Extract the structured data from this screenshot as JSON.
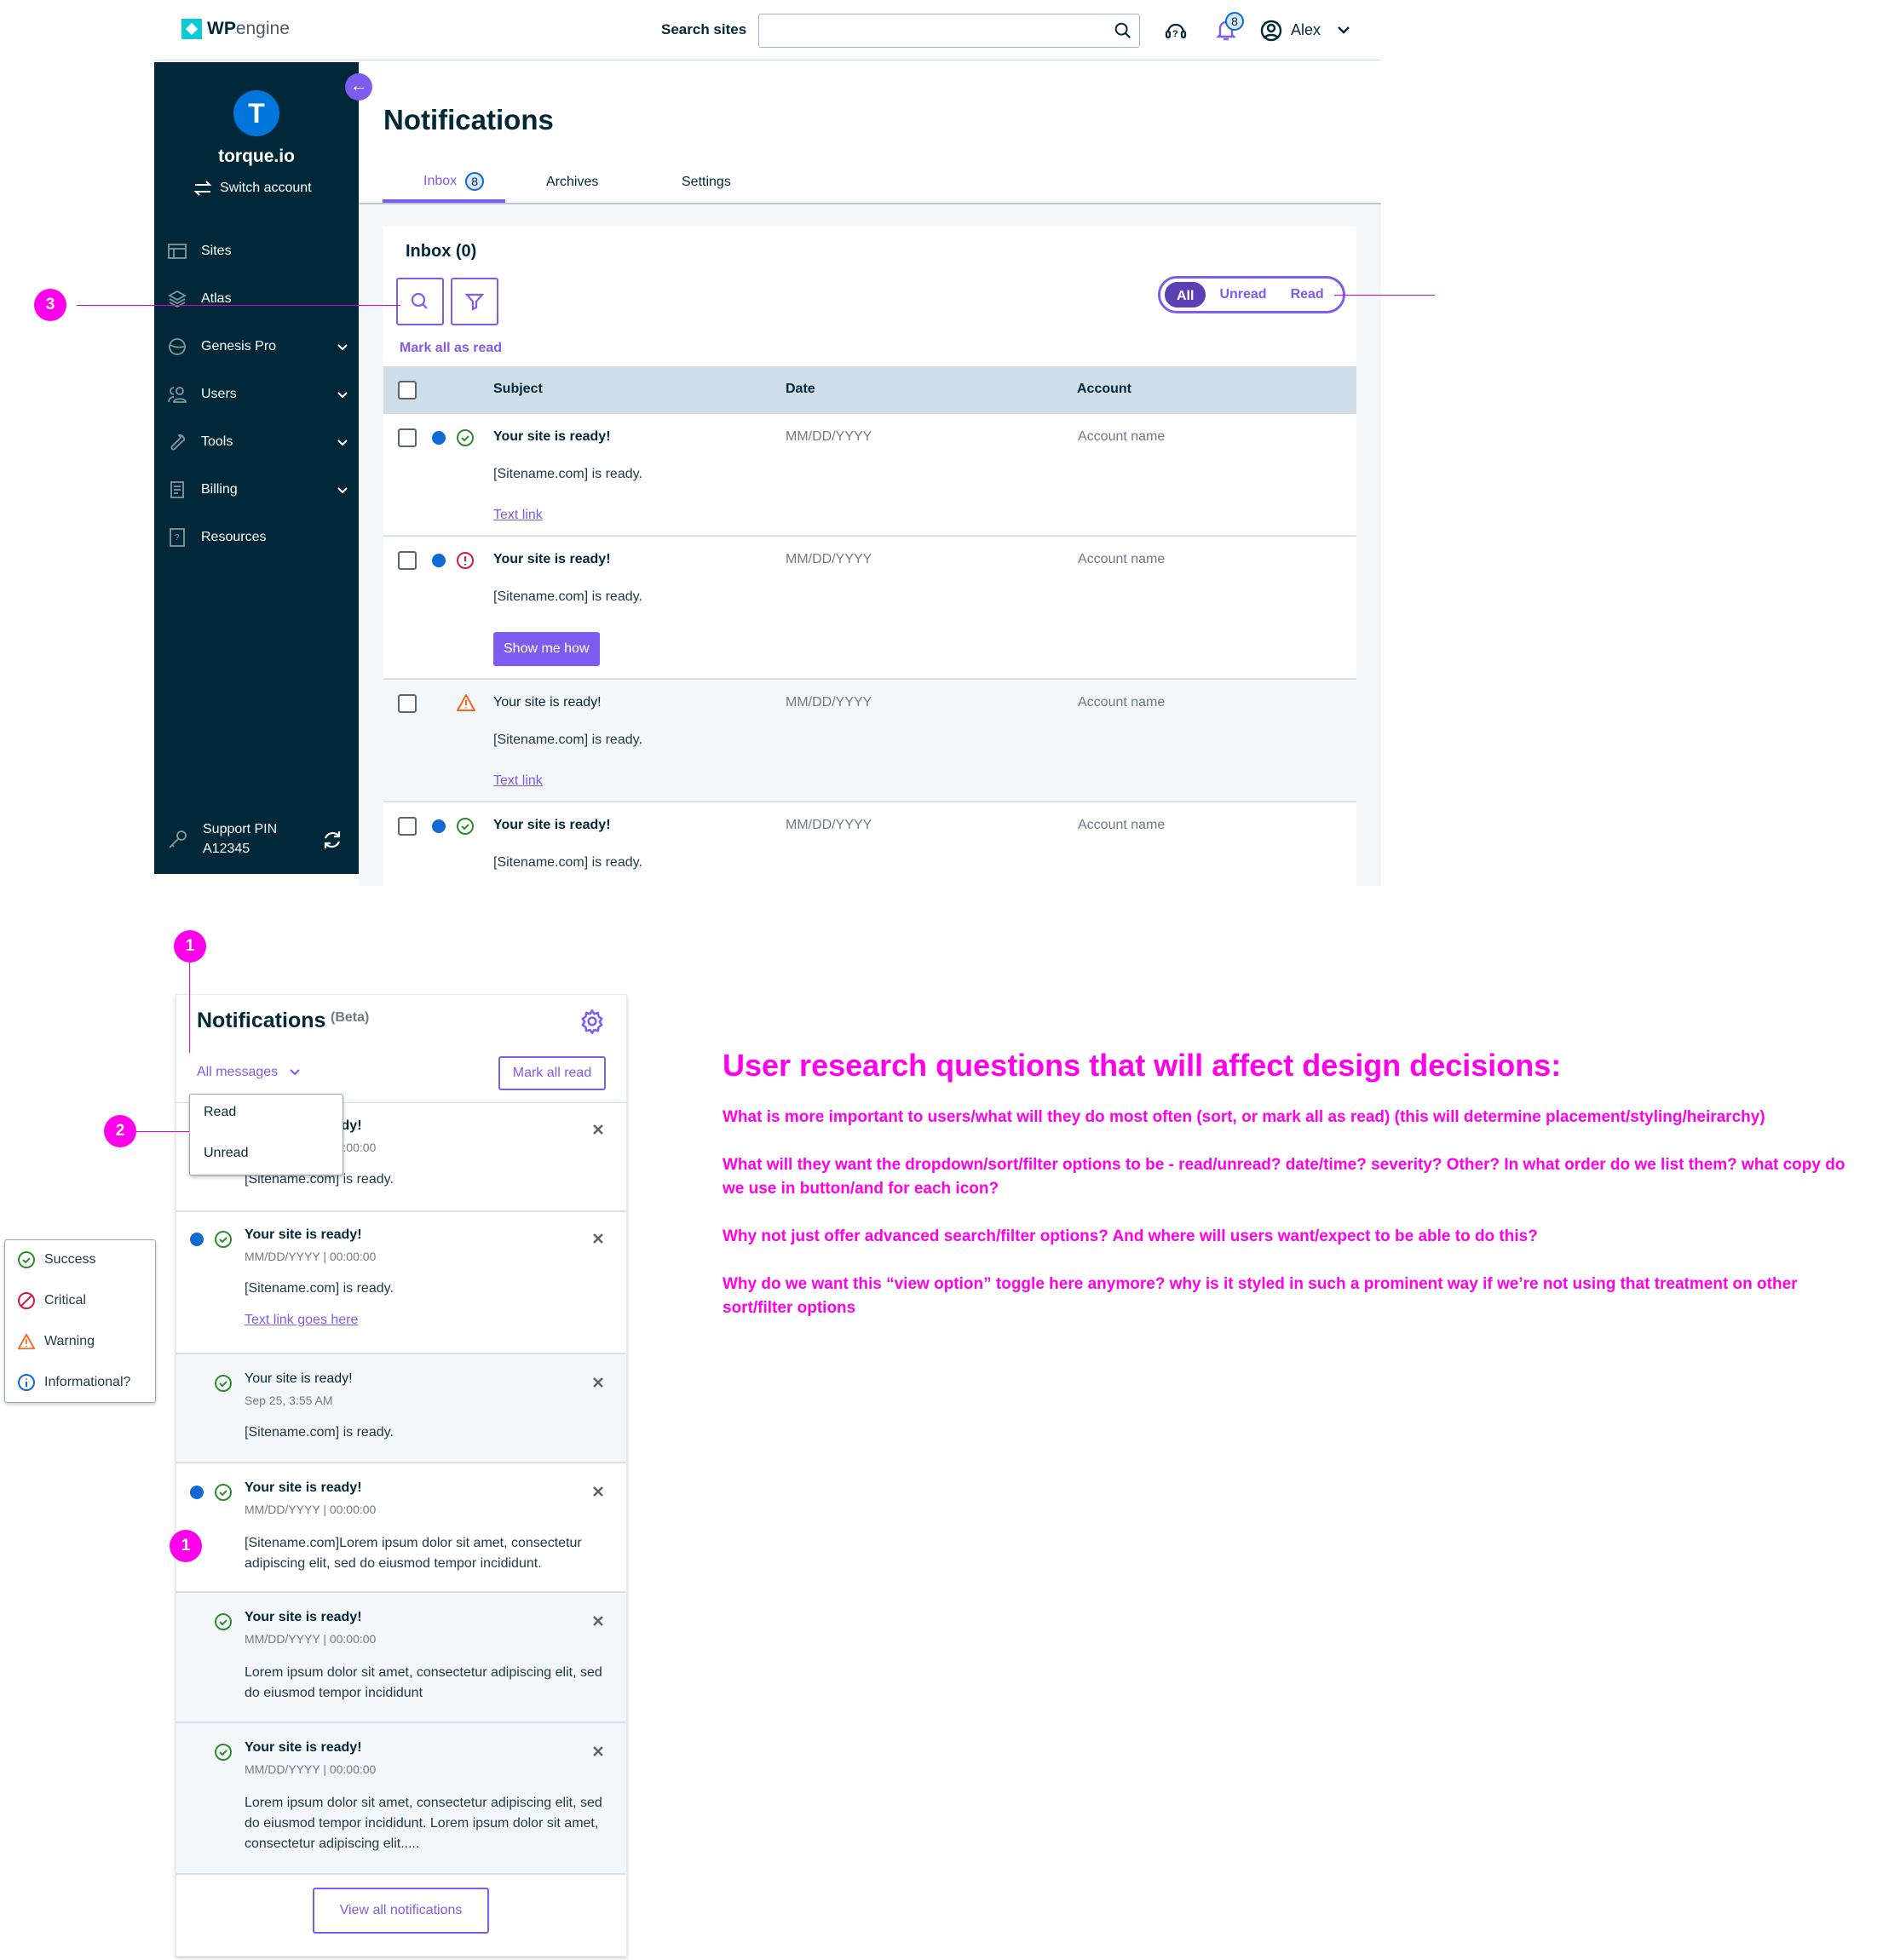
{
  "header": {
    "logo_bold": "WP",
    "logo_light": "engine",
    "search_label": "Search sites",
    "search_value": "",
    "notification_count": "8",
    "user_name": "Alex"
  },
  "sidebar": {
    "avatar_initial": "T",
    "account_name": "torque.io",
    "switch_label": "Switch account",
    "items": [
      {
        "label": "Sites",
        "icon": "sites-icon",
        "expandable": false
      },
      {
        "label": "Atlas",
        "icon": "atlas-icon",
        "expandable": false
      },
      {
        "label": "Genesis Pro",
        "icon": "genesis-icon",
        "expandable": true
      },
      {
        "label": "Users",
        "icon": "users-icon",
        "expandable": true
      },
      {
        "label": "Tools",
        "icon": "tools-icon",
        "expandable": true
      },
      {
        "label": "Billing",
        "icon": "billing-icon",
        "expandable": true
      },
      {
        "label": "Resources",
        "icon": "resources-icon",
        "expandable": false
      }
    ],
    "support_label": "Support PIN",
    "support_pin": "A12345"
  },
  "main": {
    "title": "Notifications",
    "tabs": [
      {
        "label": "Inbox",
        "badge": "8",
        "active": true
      },
      {
        "label": "Archives",
        "active": false
      },
      {
        "label": "Settings",
        "active": false
      }
    ],
    "inbox_title": "Inbox (0)",
    "mark_all_label": "Mark all as read",
    "view_toggle": {
      "options": [
        "All",
        "Unread",
        "Read"
      ],
      "selected": "All"
    },
    "table": {
      "columns": [
        "Subject",
        "Date",
        "Account"
      ],
      "rows": [
        {
          "unread": true,
          "severity": "success",
          "subject": "Your site is ready!",
          "body": "[Sitename.com] is ready.",
          "action": "Text link",
          "action_type": "link",
          "date": "MM/DD/YYYY",
          "account": "Account name"
        },
        {
          "unread": true,
          "severity": "critical",
          "subject": "Your site is ready!",
          "body": "[Sitename.com] is ready.",
          "action": "Show me how",
          "action_type": "button",
          "date": "MM/DD/YYYY",
          "account": "Account name"
        },
        {
          "unread": false,
          "severity": "warning",
          "subject": "Your site is ready!",
          "body": "[Sitename.com] is ready.",
          "action": "Text link",
          "action_type": "link",
          "date": "MM/DD/YYYY",
          "account": "Account name"
        },
        {
          "unread": true,
          "severity": "success",
          "subject": "Your site is ready!",
          "body": "[Sitename.com] is ready.",
          "date": "MM/DD/YYYY",
          "account": "Account name"
        }
      ]
    }
  },
  "annotations": {
    "a1": "1",
    "a2": "2",
    "a3": "3"
  },
  "panel": {
    "title": "Notifications",
    "beta": "(Beta)",
    "filter_label": "All messages",
    "mark_all_label": "Mark all read",
    "dropdown_options": [
      "Read",
      "Unread"
    ],
    "items": [
      {
        "unread": false,
        "subject": "Your site is ready!",
        "date": "MM/DD/YYYY | 00:00:00",
        "body": "[Sitename.com] is ready."
      },
      {
        "unread": true,
        "subject": "Your site is ready!",
        "date": "MM/DD/YYYY | 00:00:00",
        "body": "[Sitename.com] is ready.",
        "link": "Text link goes here"
      },
      {
        "unread": false,
        "subject": "Your site is ready!",
        "date": "Sep 25, 3:55 AM",
        "body": "[Sitename.com] is ready."
      },
      {
        "unread": true,
        "subject": "Your site is ready!",
        "date": "MM/DD/YYYY | 00:00:00",
        "body": "[Sitename.com]Lorem ipsum dolor sit amet, consectetur adipiscing elit, sed do eiusmod tempor incididunt."
      },
      {
        "unread": false,
        "subject": "Your site is ready!",
        "date": "MM/DD/YYYY | 00:00:00",
        "body": "Lorem ipsum dolor sit amet, consectetur adipiscing elit, sed do eiusmod tempor incididunt"
      },
      {
        "unread": false,
        "subject": "Your site is ready!",
        "date": "MM/DD/YYYY | 00:00:00",
        "body": "Lorem ipsum dolor sit amet, consectetur adipiscing elit, sed do eiusmod tempor incididunt. Lorem ipsum dolor sit amet, consectetur adipiscing elit....."
      }
    ],
    "view_all_label": "View all notifications"
  },
  "legend": [
    {
      "label": "Success",
      "color": "#2e8b2e"
    },
    {
      "label": "Critical",
      "color": "#d21b46"
    },
    {
      "label": "Warning",
      "color": "#f06a1e"
    },
    {
      "label": "Informational?",
      "color": "#0f6ad6"
    }
  ],
  "research": {
    "title": "User research questions that will affect design decisions:",
    "questions": [
      "What is more important to users/what will they do most often (sort, or mark all as read) (this will determine placement/styling/heirarchy)",
      "What will they want the dropdown/sort/filter options to be - read/unread? date/time? severity? Other? In what order do we list them? what copy do we use in button/and for each icon?",
      "Why not just offer advanced search/filter options? And where will users want/expect to be able to do this?",
      "Why do we want this “view option” toggle here anymore? why is it styled in such a prominent way if we’re not using that treatment on other sort/filter options"
    ]
  },
  "colors": {
    "accent": "#7e5cef",
    "sidebar": "#002838",
    "annotation": "#ff00ea",
    "unread": "#0f6ad6"
  }
}
